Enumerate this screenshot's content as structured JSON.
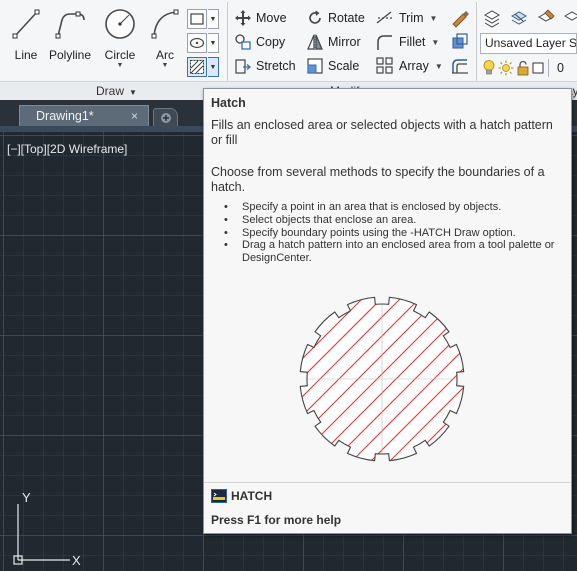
{
  "ribbon": {
    "draw_tools": [
      {
        "label": "Line",
        "icon": "line-icon"
      },
      {
        "label": "Polyline",
        "icon": "polyline-icon"
      },
      {
        "label": "Circle",
        "icon": "circle-icon"
      },
      {
        "label": "Arc",
        "icon": "arc-icon"
      }
    ],
    "modify_tools": [
      {
        "label": "Move",
        "icon": "move-icon"
      },
      {
        "label": "Rotate",
        "icon": "rotate-icon"
      },
      {
        "label": "Trim",
        "icon": "trim-icon"
      },
      {
        "label": "Copy",
        "icon": "copy-icon"
      },
      {
        "label": "Mirror",
        "icon": "mirror-icon"
      },
      {
        "label": "Fillet",
        "icon": "fillet-icon"
      },
      {
        "label": "Stretch",
        "icon": "stretch-icon"
      },
      {
        "label": "Scale",
        "icon": "scale-icon"
      },
      {
        "label": "Array",
        "icon": "array-icon"
      }
    ],
    "panels": {
      "draw_title": "Draw",
      "modify_title_partial": "Modify",
      "layers_title_partial": "ay"
    },
    "layers": {
      "current_layer": "Unsaved Layer State",
      "layer_value": "0"
    }
  },
  "tabs": {
    "active_document": "Drawing1*",
    "close_glyph": "×"
  },
  "viewport": {
    "controls": "[−][Top][2D Wireframe]",
    "ucs_y": "Y",
    "ucs_x": "X"
  },
  "tooltip": {
    "title": "Hatch",
    "description": "Fills an enclosed area or selected objects with a hatch pattern or fill",
    "extended": "Choose from several methods to specify the boundaries of a hatch.",
    "bullets": [
      "Specify a point in an area that is enclosed by objects.",
      "Select objects that enclose an area.",
      "Specify boundary points using the -HATCH Draw option.",
      "Drag a hatch pattern into an enclosed area from a tool palette or DesignCenter."
    ],
    "command": "HATCH",
    "help": "Press F1 for more help"
  },
  "colors": {
    "drawing_background": "#212830",
    "hatch_red": "#e03030",
    "tab_active": "#5d6b79",
    "ribbon_background": "#f5f6f7",
    "active_button_border": "#3e6fb3"
  }
}
